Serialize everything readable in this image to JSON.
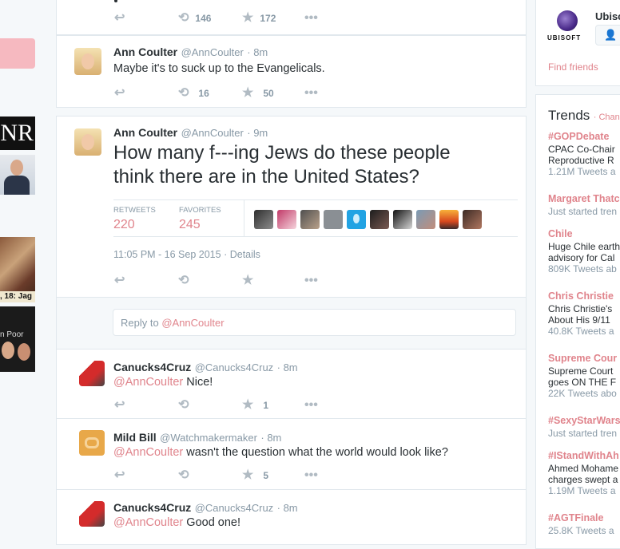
{
  "tweets": [
    {
      "actions": {
        "retweets": "146",
        "favorites": "172"
      }
    },
    {
      "name": "Ann Coulter",
      "handle": "@AnnCoulter",
      "time": "· 8m",
      "text": "Maybe it's to suck up to the Evangelicals.",
      "actions": {
        "retweets": "16",
        "favorites": "50"
      }
    }
  ],
  "main_tweet": {
    "name": "Ann Coulter",
    "handle": "@AnnCoulter",
    "time": "· 9m",
    "text_line1": "How many f---ing Jews do these people",
    "text_line2": "think there are in the United States?",
    "retweets_label": "RETWEETS",
    "retweets_count": "220",
    "favorites_label": "FAVORITES",
    "favorites_count": "245",
    "timestamp": "11:05 PM - 16 Sep 2015",
    "details": "· Details"
  },
  "reply_box": {
    "prefix": "Reply to",
    "mention": "@AnnCoulter"
  },
  "replies": [
    {
      "name": "Canucks4Cruz",
      "handle": "@Canucks4Cruz",
      "time": "· 8m",
      "mention": "@AnnCoulter",
      "text": "Nice!",
      "favorites": "1"
    },
    {
      "name": "Mild Bill",
      "handle": "@Watchmakermaker",
      "time": "· 8m",
      "mention": "@AnnCoulter",
      "text": "wasn't the question what the world would look like?",
      "favorites": "5"
    },
    {
      "name": "Canucks4Cruz",
      "handle": "@Canucks4Cruz",
      "time": "· 8m",
      "mention": "@AnnCoulter",
      "text": "Good one!"
    }
  ],
  "left": {
    "nr_logo": "NR",
    "thumb_caption": ", 18: Jag",
    "thumb_caption2": "n Poor"
  },
  "who_to_follow": {
    "name": "Ubisc",
    "logo_text": "UBISOFT",
    "find_friends": "Find friends"
  },
  "trends": {
    "title": "Trends",
    "change": "· Chan",
    "items": [
      {
        "name": "#GOPDebate",
        "line1": "CPAC Co-Chair",
        "line2": "Reproductive R",
        "count": "1.21M Tweets a"
      },
      {
        "name": "Margaret Thatc",
        "line1": "Just started tren"
      },
      {
        "name": "Chile",
        "line1": "Huge Chile earth",
        "line2": "advisory for Cal",
        "count": "809K Tweets ab"
      },
      {
        "name": "Chris Christie",
        "line1": "Chris Christie's",
        "line2": "About His 9/11",
        "count": "40.8K Tweets a"
      },
      {
        "name": "Supreme Cour",
        "line1": "Supreme Court",
        "line2": "goes ON THE F",
        "count": "22K Tweets abo"
      },
      {
        "name": "#SexyStarWars",
        "line1": "Just started tren"
      },
      {
        "name": "#IStandWithAh",
        "line1": "Ahmed Mohame",
        "line2": "charges swept a",
        "count": "1.19M Tweets a"
      },
      {
        "name": "#AGTFinale",
        "count": "25.8K Tweets a"
      }
    ]
  },
  "colors": {
    "accent": "#e0848c",
    "border": "#e1e8ed",
    "muted": "#8899a6",
    "pink_button": "#f6b9c0"
  },
  "icons": [
    "reply-icon",
    "retweet-icon",
    "favorite-icon",
    "more-icon",
    "follow-icon"
  ]
}
